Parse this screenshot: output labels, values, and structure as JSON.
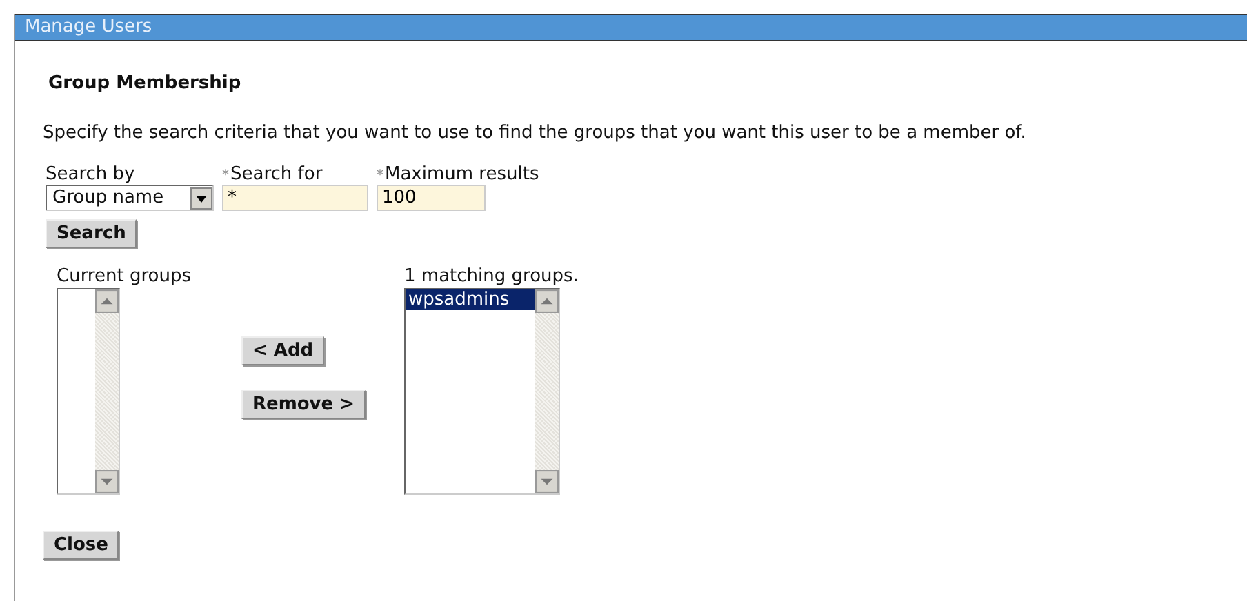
{
  "window": {
    "title": "Manage Users"
  },
  "heading": "Group Membership",
  "description": "Specify the search criteria that you want to use to find the groups that you want this user to be a member of.",
  "search_by": {
    "label": "Search by",
    "value": "Group name"
  },
  "search_for": {
    "mark": "*",
    "label": "Search for",
    "value": "*"
  },
  "max_results": {
    "mark": "*",
    "label": "Maximum results",
    "value": "100"
  },
  "search_button": "Search",
  "current_groups": {
    "label": "Current groups"
  },
  "add_button": "< Add",
  "remove_button": "Remove >",
  "matching_groups": {
    "label": "1 matching groups.",
    "items": [
      {
        "name": "wpsadmins",
        "selected": true
      }
    ]
  },
  "close_button": "Close"
}
